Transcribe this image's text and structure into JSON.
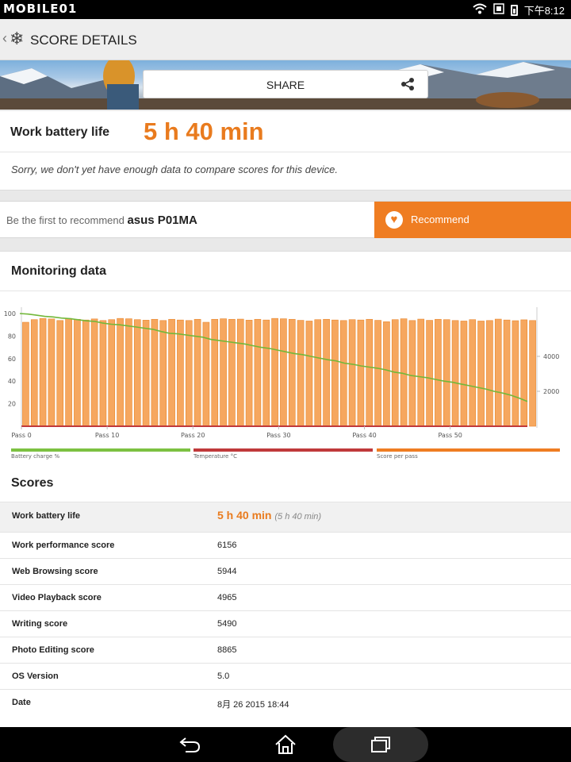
{
  "statusbar": {
    "brand": "MOBILE01",
    "time": "下午8:12"
  },
  "appbar": {
    "title": "SCORE DETAILS"
  },
  "banner": {
    "share_label": "SHARE"
  },
  "battery": {
    "label": "Work battery life",
    "value": "5 h 40 min",
    "note": "Sorry, we don't yet have enough data to compare scores for this device."
  },
  "recommend": {
    "prefix": "Be the first to recommend ",
    "device": "asus P01MA",
    "button_label": "Recommend"
  },
  "monitoring": {
    "title": "Monitoring data",
    "legend": [
      {
        "label": "Battery charge %",
        "color": "#7cc142"
      },
      {
        "label": "Temperature °C",
        "color": "#c0393b"
      },
      {
        "label": "Score per pass",
        "color": "#ef7d22"
      }
    ]
  },
  "chart_data": {
    "type": "bar",
    "left_axis_ticks": [
      "100",
      "80",
      "60",
      "40",
      "20"
    ],
    "right_axis_ticks": [
      "4000",
      "2000"
    ],
    "x_tick_labels": [
      "Pass 0",
      "Pass 10",
      "Pass 20",
      "Pass 30",
      "Pass 40",
      "Pass 50"
    ],
    "left_ylim": [
      0,
      100
    ],
    "right_ylim": [
      0,
      6450
    ],
    "series": [
      {
        "name": "Score per pass",
        "axis": "right",
        "values": [
          5950,
          6100,
          6170,
          6140,
          6050,
          6170,
          6120,
          6080,
          6140,
          6050,
          6100,
          6170,
          6150,
          6100,
          6070,
          6120,
          6050,
          6120,
          6080,
          6050,
          6120,
          5950,
          6120,
          6150,
          6120,
          6130,
          6070,
          6120,
          6080,
          6170,
          6150,
          6120,
          6060,
          6020,
          6100,
          6120,
          6080,
          6050,
          6100,
          6080,
          6120,
          6060,
          5980,
          6100,
          6150,
          6050,
          6130,
          6060,
          6120,
          6100,
          6050,
          6020,
          6100,
          6020,
          6050,
          6130,
          6080,
          6040,
          6090,
          6050
        ]
      },
      {
        "name": "Battery charge %",
        "axis": "left",
        "values": [
          100,
          99.5,
          98.5,
          97.5,
          97,
          96,
          95.5,
          94.5,
          93.5,
          93,
          91.5,
          90.5,
          90,
          89,
          88,
          87,
          86,
          84,
          82.5,
          82,
          81,
          80,
          79,
          77,
          76,
          75,
          74,
          73,
          71.5,
          70,
          69,
          67.5,
          66,
          64.5,
          63.5,
          62,
          60.5,
          59,
          58,
          56,
          55,
          53.5,
          52.5,
          51.5,
          50,
          48,
          47,
          45,
          44,
          43,
          41.5,
          40,
          39,
          37.5,
          36,
          34.5,
          33,
          31,
          29.5,
          27.5,
          25,
          22
        ]
      },
      {
        "name": "Temperature °C",
        "axis": "none",
        "values": []
      }
    ]
  },
  "scores": {
    "title": "Scores",
    "rows": [
      {
        "label": "Work battery life",
        "value": "5 h 40 min",
        "sub": "(5 h 40 min)"
      },
      {
        "label": "Work performance score",
        "value": "6156"
      },
      {
        "label": "Web Browsing score",
        "value": "5944"
      },
      {
        "label": "Video Playback score",
        "value": "4965"
      },
      {
        "label": "Writing score",
        "value": "5490"
      },
      {
        "label": "Photo Editing score",
        "value": "8865"
      },
      {
        "label": "OS Version",
        "value": "5.0"
      },
      {
        "label": "Date",
        "value": "8月 26 2015 18:44"
      }
    ]
  }
}
